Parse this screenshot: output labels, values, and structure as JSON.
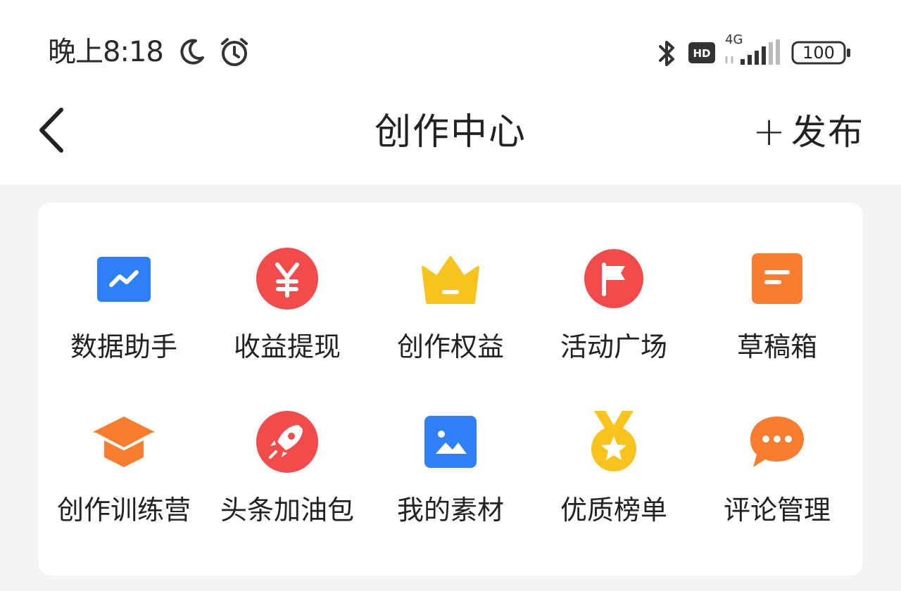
{
  "status_bar": {
    "time": "晚上8:18",
    "network": "4G",
    "battery": "100",
    "icons": [
      "moon-icon",
      "alarm-icon",
      "bluetooth-icon",
      "hd-icon",
      "signal-icon",
      "battery-icon"
    ]
  },
  "nav": {
    "back_icon": "chevron-left-icon",
    "title": "创作中心",
    "publish_plus": "+",
    "publish_label": "发布"
  },
  "tools": [
    {
      "label": "数据助手",
      "icon": "data-chart-icon",
      "color": "#2f7ff6"
    },
    {
      "label": "收益提现",
      "icon": "yuan-coin-icon",
      "color": "#f24b4b"
    },
    {
      "label": "创作权益",
      "icon": "crown-icon",
      "color": "#f7c31c"
    },
    {
      "label": "活动广场",
      "icon": "flag-icon",
      "color": "#f24b4b"
    },
    {
      "label": "草稿箱",
      "icon": "draft-note-icon",
      "color": "#f87d2e"
    },
    {
      "label": "创作训练营",
      "icon": "graduation-cap-icon",
      "color": "#f87d2e"
    },
    {
      "label": "头条加油包",
      "icon": "rocket-icon",
      "color": "#f24b4b"
    },
    {
      "label": "我的素材",
      "icon": "image-gallery-icon",
      "color": "#2f7ff6"
    },
    {
      "label": "优质榜单",
      "icon": "star-medal-icon",
      "color": "#f7c31c"
    },
    {
      "label": "评论管理",
      "icon": "comment-bubble-icon",
      "color": "#f87d2e"
    }
  ]
}
